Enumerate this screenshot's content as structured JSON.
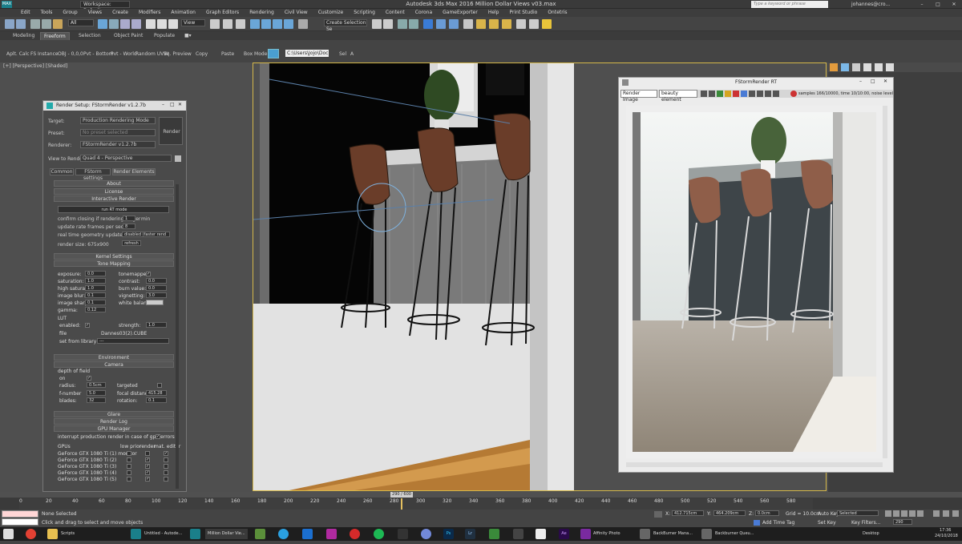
{
  "window": {
    "title": "Autodesk 3ds Max 2016    Million Dollar Views v03.max",
    "workspace": "Workspace: Default",
    "search_placeholder": "Type a keyword or phrase",
    "user": "johannes@cro..."
  },
  "menu": [
    "Edit",
    "Tools",
    "Group",
    "Views",
    "Create",
    "Modifiers",
    "Animation",
    "Graph Editors",
    "Rendering",
    "Civil View",
    "Customize",
    "Scripting",
    "Content",
    "Corona",
    "GameExporter",
    "Help",
    "Print Studio",
    "Ontetris"
  ],
  "toolbar": {
    "selection_filter": "All",
    "ref_coord": "View",
    "named_set": "Create Selection Se"
  },
  "ribbon_tabs": [
    "Modeling",
    "Freeform",
    "Selection",
    "Object Paint",
    "Populate"
  ],
  "ribbon_active": "Freeform",
  "ribbon_tools": [
    "Aplt. Calc",
    "FS Instance",
    "OBJ - 0,0,0",
    "Pvt - Bottom",
    "Pvt - World",
    "Random UVW",
    "Sq. Preview",
    "Copy",
    "Paste",
    "Box Mode",
    "C:\\Users\\Jojo\\Docur",
    "Sel"
  ],
  "viewport_label": "[+] [Perspective] [Shaded]",
  "render_setup": {
    "title": "Render Setup: FStormRender v1.2.7b",
    "target_label": "Target:",
    "target_value": "Production Rendering Mode",
    "preset_label": "Preset:",
    "preset_value": "No preset selected",
    "renderer_label": "Renderer:",
    "renderer_value": "FStormRender v1.2.7b",
    "view_label": "View to Render:",
    "view_value": "Quad 4 - Perspective",
    "render_btn": "Render",
    "tabs": [
      "Common",
      "FStorm settings",
      "Render Elements"
    ],
    "sections": {
      "about": "About",
      "license": "License",
      "interactive": "Interactive Render",
      "kernel": "Kernel Settings",
      "tone": "Tone Mapping",
      "environment": "Environment",
      "camera": "Camera",
      "glare": "Glare",
      "render_log": "Render Log",
      "gpu": "GPU Manager"
    },
    "interactive": {
      "run_rt": "run RT mode",
      "confirm_label": "confirm closing if rendering longer",
      "confirm_val": "1",
      "confirm_unit": "min",
      "update_rate_label": "update rate frames per seconds",
      "update_rate_val": "8",
      "geom_label": "real time geometry update",
      "geom_val": "disabled (faster rend",
      "render_size": "render size: 675x900",
      "refresh": "refresh"
    },
    "tone": {
      "exposure_l": "exposure:",
      "exposure": "0.0",
      "saturation_l": "saturation:",
      "saturation": "1.0",
      "highsat_l": "high saturat:",
      "highsat": "1.0",
      "blur_l": "image blur:",
      "blur": "0.1",
      "sharp_l": "image sharp:",
      "sharp": "0.1",
      "gamma_l": "gamma:",
      "gamma": "0.12",
      "tonemapped_l": "tonemapped:",
      "contrast_l": "contrast:",
      "contrast": "0.0",
      "burn_l": "burn value:",
      "burn": "0.0",
      "vignetting_l": "vignetting:",
      "vignetting": "3.0",
      "wb_l": "white balance:",
      "lut_l": "LUT",
      "enabled_l": "enabled:",
      "strength_l": "strength:",
      "strength": "1.0",
      "file_l": "file",
      "file": "Dannes03(2).CUBE",
      "library_l": "set from library",
      "library": "---"
    },
    "camera": {
      "dof_l": "depth of field",
      "on_l": "on",
      "radius_l": "radius:",
      "radius": "0.5cm",
      "targeted_l": "targeted",
      "fnumber_l": "f-number",
      "fnumber": "5.0",
      "focal_l": "focal distance:",
      "focal": "415.28",
      "blades_l": "blades:",
      "blades": "32",
      "rotation_l": "rotation:",
      "rotation": "0.1"
    },
    "gpu": {
      "interrupt": "interrupt production render in case of gpu errors",
      "cols": [
        "GPUs",
        "low prior",
        "render",
        "mat. editor"
      ],
      "devices": [
        "GeForce GTX 1080 Ti (1) monitor",
        "GeForce GTX 1080 Ti (2)",
        "GeForce GTX 1080 Ti (3)",
        "GeForce GTX 1080 Ti (4)",
        "GeForce GTX 1080 Ti (5)"
      ]
    }
  },
  "fstorm": {
    "title": "FStormRender RT",
    "channel": "Render Image",
    "element": "beauty element",
    "status": "samples 166/10000,  time 10/10:00,  noise level"
  },
  "timeline": {
    "frame": "290 / 600",
    "ticks": [
      "0",
      "20",
      "40",
      "60",
      "80",
      "100",
      "120",
      "140",
      "160",
      "180",
      "200",
      "220",
      "240",
      "260",
      "280",
      "300",
      "320",
      "340",
      "360",
      "380",
      "400",
      "420",
      "440",
      "460",
      "480",
      "500",
      "520",
      "540",
      "560",
      "580"
    ]
  },
  "status": {
    "selection": "None Selected",
    "prompt": "Click and drag to select and move objects",
    "x": "412.715cm",
    "y": "464.209cm",
    "z": "0.0cm",
    "grid": "Grid = 10.0cm",
    "autokey": "Auto Key",
    "autokey_val": "Selected",
    "setkey": "Set Key",
    "keyfilters": "Key Filters...",
    "addtimetag": "Add Time Tag",
    "frame_field": "290"
  },
  "taskbar": {
    "items": [
      "Scripts",
      "Untitled - Autode...",
      "Million Dollar Vie...",
      "Affinity Photo",
      "BackBurner Mana...",
      "Backburner Queu...",
      "Desktop"
    ],
    "time": "17:36",
    "date": "24/10/2018"
  }
}
